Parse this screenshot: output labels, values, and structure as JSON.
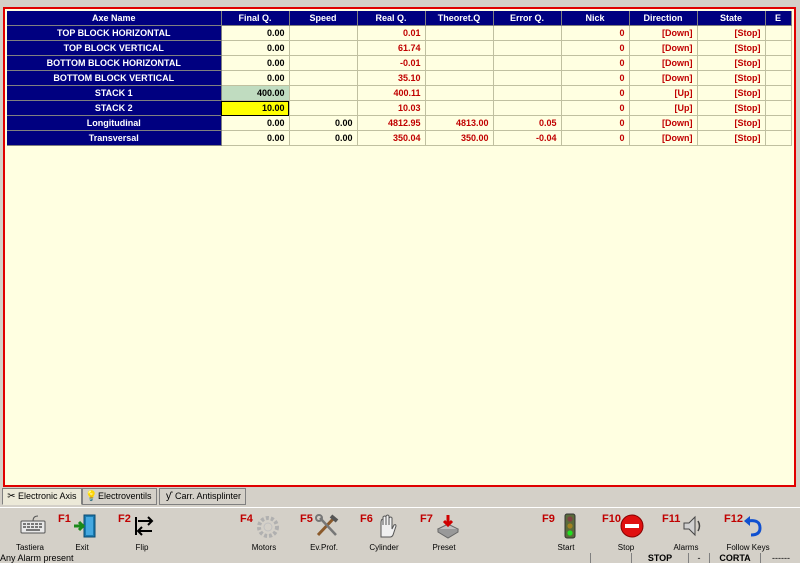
{
  "table": {
    "columns": [
      "Axe Name",
      "Final Q.",
      "Speed",
      "Real Q.",
      "Theoret.Q",
      "Error Q.",
      "Nick",
      "Direction",
      "State",
      "E"
    ],
    "rows": [
      {
        "name": "TOP BLOCK HORIZONTAL",
        "final_q": "0.00",
        "speed": "",
        "real_q": "0.01",
        "theoret_q": "",
        "error_q": "",
        "nick": "0",
        "direction": "[Down]",
        "state": "[Stop]"
      },
      {
        "name": "TOP BLOCK VERTICAL",
        "final_q": "0.00",
        "speed": "",
        "real_q": "61.74",
        "theoret_q": "",
        "error_q": "",
        "nick": "0",
        "direction": "[Down]",
        "state": "[Stop]"
      },
      {
        "name": "BOTTOM BLOCK HORIZONTAL",
        "final_q": "0.00",
        "speed": "",
        "real_q": "-0.01",
        "theoret_q": "",
        "error_q": "",
        "nick": "0",
        "direction": "[Down]",
        "state": "[Stop]"
      },
      {
        "name": "BOTTOM BLOCK VERTICAL",
        "final_q": "0.00",
        "speed": "",
        "real_q": "35.10",
        "theoret_q": "",
        "error_q": "",
        "nick": "0",
        "direction": "[Down]",
        "state": "[Stop]"
      },
      {
        "name": "STACK 1",
        "final_q": "400.00",
        "speed": "",
        "real_q": "400.11",
        "theoret_q": "",
        "error_q": "",
        "nick": "0",
        "direction": "[Up]",
        "state": "[Stop]"
      },
      {
        "name": "STACK 2",
        "final_q": "10.00",
        "speed": "",
        "real_q": "10.03",
        "theoret_q": "",
        "error_q": "",
        "nick": "0",
        "direction": "[Up]",
        "state": "[Stop]"
      },
      {
        "name": "Longitudinal",
        "final_q": "0.00",
        "speed": "0.00",
        "real_q": "4812.95",
        "theoret_q": "4813.00",
        "error_q": "0.05",
        "nick": "0",
        "direction": "[Down]",
        "state": "[Stop]"
      },
      {
        "name": "Transversal",
        "final_q": "0.00",
        "speed": "0.00",
        "real_q": "350.04",
        "theoret_q": "350.00",
        "error_q": "-0.04",
        "nick": "0",
        "direction": "[Down]",
        "state": "[Stop]"
      }
    ]
  },
  "tabs": [
    {
      "label": "Electronic Axis",
      "icon": "tools-icon",
      "active": true
    },
    {
      "label": "Electroventils",
      "icon": "lightbulb-icon",
      "active": false
    },
    {
      "label": "Carr. Antisplinter",
      "icon": "wrench-icon",
      "active": false
    }
  ],
  "toolbar": {
    "keyboard": {
      "key": "",
      "label": "Tastiera",
      "icon": "keyboard-icon"
    },
    "f1": {
      "key": "F1",
      "label": "Exit",
      "icon": "exit-door-icon"
    },
    "f2": {
      "key": "F2",
      "label": "Flip",
      "icon": "flip-arrows-icon"
    },
    "f4": {
      "key": "F4",
      "label": "Motors",
      "icon": "gear-icon"
    },
    "f5": {
      "key": "F5",
      "label": "Ev.Prof.",
      "icon": "tools-icon"
    },
    "f6": {
      "key": "F6",
      "label": "Cylinder",
      "icon": "hand-icon"
    },
    "f7": {
      "key": "F7",
      "label": "Preset",
      "icon": "preset-icon"
    },
    "f9": {
      "key": "F9",
      "label": "Start",
      "icon": "traffic-light-icon"
    },
    "f10": {
      "key": "F10",
      "label": "Stop",
      "icon": "stop-sign-icon"
    },
    "f11": {
      "key": "F11",
      "label": "Alarms",
      "icon": "speaker-icon"
    },
    "f12": {
      "key": "F12",
      "label": "Follow Keys",
      "icon": "follow-arrow-icon"
    }
  },
  "status": {
    "message": "Any Alarm present",
    "state": "STOP",
    "separator": "-",
    "mode": "CORTA",
    "extra": "------"
  },
  "colors": {
    "header_bg": "#000080",
    "grid_bg": "#ffffe1",
    "value_red": "#c00000",
    "frame_red": "#e00000",
    "highlight_yellow": "#ffff00",
    "highlight_green": "#c0dcc0"
  }
}
